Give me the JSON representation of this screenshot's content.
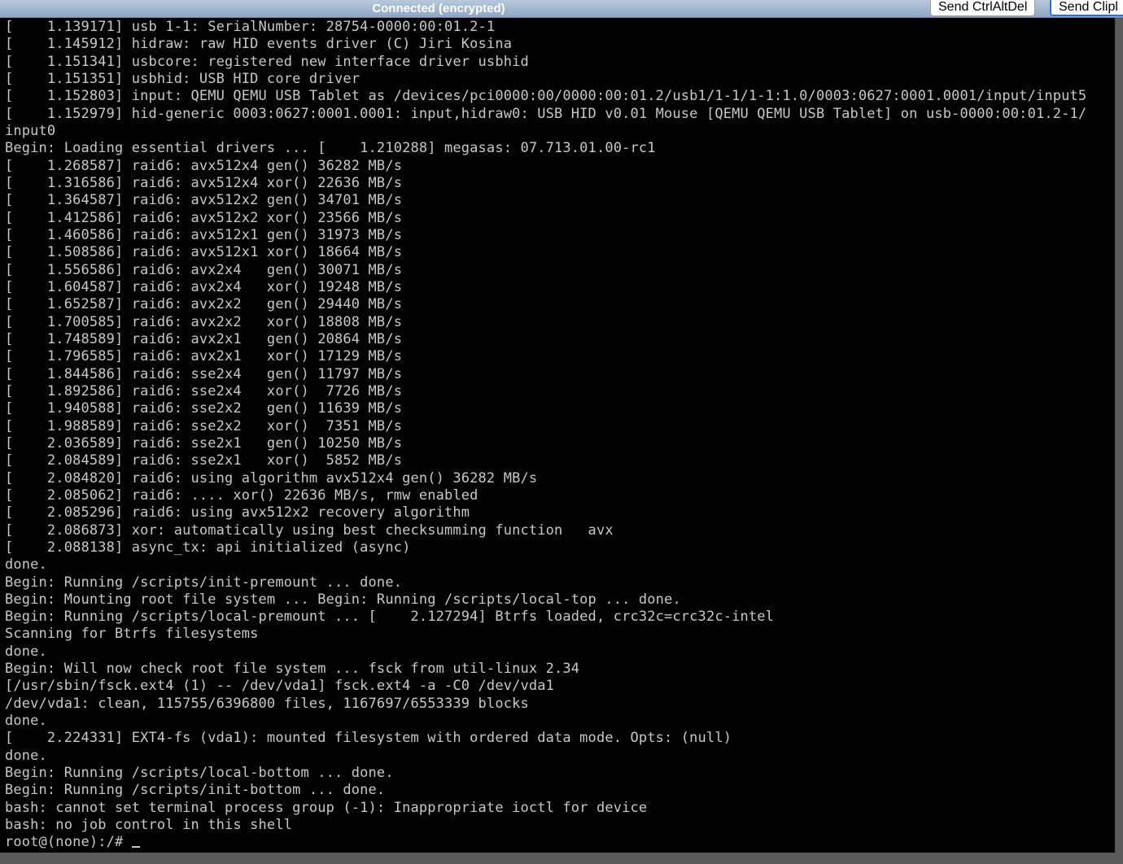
{
  "toolbar": {
    "status": "Connected (encrypted)",
    "send_ctrlaltdel_label": "Send CtrlAltDel",
    "send_clipboard_label": "Send Clipl"
  },
  "console": {
    "lines": [
      "[    1.139171] usb 1-1: SerialNumber: 28754-0000:00:01.2-1",
      "[    1.145912] hidraw: raw HID events driver (C) Jiri Kosina",
      "[    1.151341] usbcore: registered new interface driver usbhid",
      "[    1.151351] usbhid: USB HID core driver",
      "[    1.152803] input: QEMU QEMU USB Tablet as /devices/pci0000:00/0000:00:01.2/usb1/1-1/1-1:1.0/0003:0627:0001.0001/input/input5",
      "[    1.152979] hid-generic 0003:0627:0001.0001: input,hidraw0: USB HID v0.01 Mouse [QEMU QEMU USB Tablet] on usb-0000:00:01.2-1/",
      "input0",
      "Begin: Loading essential drivers ... [    1.210288] megasas: 07.713.01.00-rc1",
      "[    1.268587] raid6: avx512x4 gen() 36282 MB/s",
      "[    1.316586] raid6: avx512x4 xor() 22636 MB/s",
      "[    1.364587] raid6: avx512x2 gen() 34701 MB/s",
      "[    1.412586] raid6: avx512x2 xor() 23566 MB/s",
      "[    1.460586] raid6: avx512x1 gen() 31973 MB/s",
      "[    1.508586] raid6: avx512x1 xor() 18664 MB/s",
      "[    1.556586] raid6: avx2x4   gen() 30071 MB/s",
      "[    1.604587] raid6: avx2x4   xor() 19248 MB/s",
      "[    1.652587] raid6: avx2x2   gen() 29440 MB/s",
      "[    1.700585] raid6: avx2x2   xor() 18808 MB/s",
      "[    1.748589] raid6: avx2x1   gen() 20864 MB/s",
      "[    1.796585] raid6: avx2x1   xor() 17129 MB/s",
      "[    1.844586] raid6: sse2x4   gen() 11797 MB/s",
      "[    1.892586] raid6: sse2x4   xor()  7726 MB/s",
      "[    1.940588] raid6: sse2x2   gen() 11639 MB/s",
      "[    1.988589] raid6: sse2x2   xor()  7351 MB/s",
      "[    2.036589] raid6: sse2x1   gen() 10250 MB/s",
      "[    2.084589] raid6: sse2x1   xor()  5852 MB/s",
      "[    2.084820] raid6: using algorithm avx512x4 gen() 36282 MB/s",
      "[    2.085062] raid6: .... xor() 22636 MB/s, rmw enabled",
      "[    2.085296] raid6: using avx512x2 recovery algorithm",
      "[    2.086873] xor: automatically using best checksumming function   avx",
      "[    2.088138] async_tx: api initialized (async)",
      "done.",
      "Begin: Running /scripts/init-premount ... done.",
      "Begin: Mounting root file system ... Begin: Running /scripts/local-top ... done.",
      "Begin: Running /scripts/local-premount ... [    2.127294] Btrfs loaded, crc32c=crc32c-intel",
      "Scanning for Btrfs filesystems",
      "done.",
      "Begin: Will now check root file system ... fsck from util-linux 2.34",
      "[/usr/sbin/fsck.ext4 (1) -- /dev/vda1] fsck.ext4 -a -C0 /dev/vda1",
      "/dev/vda1: clean, 115755/6396800 files, 1167697/6553339 blocks",
      "done.",
      "[    2.224331] EXT4-fs (vda1): mounted filesystem with ordered data mode. Opts: (null)",
      "done.",
      "Begin: Running /scripts/local-bottom ... done.",
      "Begin: Running /scripts/init-bottom ... done.",
      "bash: cannot set terminal process group (-1): Inappropriate ioctl for device",
      "bash: no job control in this shell"
    ],
    "prompt": "root@(none):/# "
  }
}
